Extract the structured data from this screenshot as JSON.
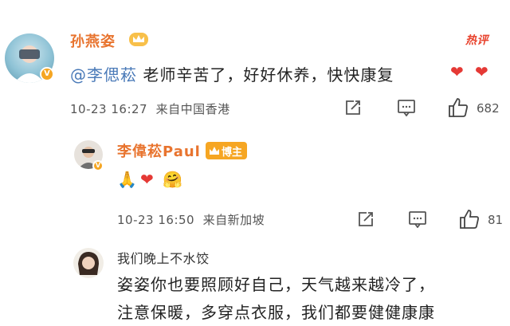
{
  "comment1": {
    "username": "孙燕姿",
    "hot_badge": "热评",
    "mention": "@李偲菘",
    "body": " 老师辛苦了，好好休养，快快康复",
    "emojis": [
      "heart-emoji",
      "heart-emoji"
    ],
    "timestamp": "10-23 16:27",
    "location": "来自中国香港",
    "like_count": "682"
  },
  "reply1": {
    "username": "李偉菘Paul",
    "author_badge": "博主",
    "emojis": [
      "folded-hands-emoji",
      "heart-emoji",
      "hugging-face-emoji"
    ],
    "timestamp": "10-23 16:50",
    "location": "来自新加坡",
    "like_count": "81"
  },
  "comment2": {
    "username": "我们晚上不水饺",
    "line1": "姿姿你也要照顾好自己，天气越来越冷了，",
    "line2": "注意保暖，多穿点衣服，我们都要健健康康"
  },
  "colors": {
    "username": "#e8742f",
    "mention": "#4a7ab8",
    "verified_badge": "#f5a623",
    "hot": "#e8442f"
  }
}
